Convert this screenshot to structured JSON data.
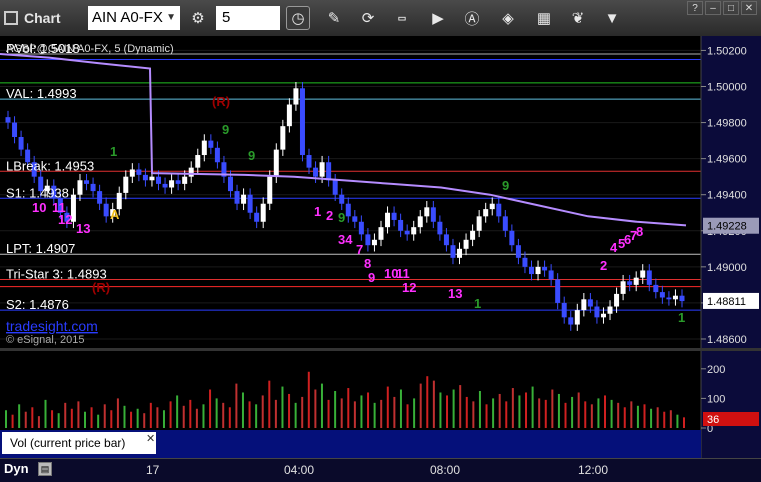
{
  "toolbar": {
    "title": "Chart",
    "symbol": "AIN A0-FX",
    "interval": "5",
    "icons": [
      "settings-icon",
      "clock-icon",
      "pencil-icon",
      "refresh-icon",
      "get-icon",
      "play-icon",
      "text-icon",
      "tag-icon",
      "calendar-icon",
      "twitter-icon",
      "dropdown-icon"
    ]
  },
  "chart_data": [
    {
      "type": "candlestick",
      "title": "AGBP@GAIN A0-FX, 5 (Dynamic)",
      "y_axis_ticks": [
        "1.50200",
        "1.50000",
        "1.49800",
        "1.49600",
        "1.49400",
        "1.49200",
        "1.49000",
        "1.48800",
        "1.48600"
      ],
      "ylim": [
        1.4855,
        1.5028
      ],
      "last_price_label": "1.48811",
      "ma_value_label": "1.49228",
      "x_ticks": [
        "17",
        "04:00",
        "08:00",
        "12:00"
      ],
      "levels": [
        {
          "label": "PVol: 1.5018",
          "value": 1.5018,
          "color": "#b0b0b0"
        },
        {
          "label": "",
          "value": 1.5015,
          "color": "#2a3cff"
        },
        {
          "label": "",
          "value": 1.5002,
          "color": "#22c022"
        },
        {
          "label": "VAL: 1.4993",
          "value": 1.4993,
          "color": "#60c0e0"
        },
        {
          "label": "LBreak: 1.4953",
          "value": 1.4953,
          "color": "#e03030"
        },
        {
          "label": "S1: 1.4938",
          "value": 1.4938,
          "color": "#2a3cff"
        },
        {
          "label": "LPT: 1.4907",
          "value": 1.4907,
          "color": "#c0c0c0"
        },
        {
          "label": "Tri-Star 3: 1.4893",
          "value": 1.4893,
          "color": "#e03030"
        },
        {
          "label": "",
          "value": 1.4889,
          "color": "#ff2a2a"
        },
        {
          "label": "S2: 1.4876",
          "value": 1.4876,
          "color": "#2a3cff"
        }
      ],
      "closes": [
        1.498,
        1.4972,
        1.4965,
        1.4958,
        1.495,
        1.4942,
        1.4945,
        1.4938,
        1.493,
        1.4925,
        1.494,
        1.4948,
        1.4946,
        1.4942,
        1.4935,
        1.4928,
        1.4932,
        1.4941,
        1.495,
        1.4954,
        1.4951,
        1.4948,
        1.495,
        1.4946,
        1.4944,
        1.4948,
        1.4946,
        1.495,
        1.4955,
        1.4962,
        1.497,
        1.4966,
        1.4958,
        1.495,
        1.4942,
        1.4935,
        1.494,
        1.493,
        1.4925,
        1.4935,
        1.495,
        1.4965,
        1.4978,
        1.499,
        1.4999,
        1.4962,
        1.4955,
        1.495,
        1.4958,
        1.4948,
        1.494,
        1.4935,
        1.4928,
        1.4925,
        1.4918,
        1.4912,
        1.4915,
        1.4922,
        1.493,
        1.4926,
        1.492,
        1.4918,
        1.4922,
        1.4928,
        1.4933,
        1.4925,
        1.4918,
        1.4912,
        1.4905,
        1.491,
        1.4915,
        1.492,
        1.4928,
        1.4932,
        1.4935,
        1.4928,
        1.492,
        1.4912,
        1.4905,
        1.49,
        1.4896,
        1.49,
        1.4898,
        1.4893,
        1.488,
        1.4872,
        1.4868,
        1.4876,
        1.4882,
        1.4878,
        1.4872,
        1.4874,
        1.4878,
        1.4885,
        1.4892,
        1.489,
        1.4894,
        1.4898,
        1.489,
        1.4886,
        1.4883,
        1.4882,
        1.4884,
        1.4881
      ],
      "ma_line": [
        1.5018,
        1.5016,
        1.5013,
        1.501,
        1.4952,
        1.4951,
        1.495,
        1.4948,
        1.4946,
        1.4944,
        1.494,
        1.4934,
        1.4928,
        1.4925,
        1.4923
      ],
      "annotations": [
        {
          "text": "(R)",
          "color": "#a00000"
        },
        {
          "text": "(R)",
          "color": "#a00000"
        },
        {
          "text": "A",
          "color": "#f0c020"
        },
        {
          "text": "10",
          "color": "#ff30ff"
        },
        {
          "text": "11",
          "color": "#ff30ff"
        },
        {
          "text": "12",
          "color": "#ff30ff"
        },
        {
          "text": "13",
          "color": "#ff30ff"
        },
        {
          "text": "1",
          "color": "#ff30ff"
        },
        {
          "text": "2",
          "color": "#ff30ff"
        },
        {
          "text": "34",
          "color": "#ff30ff"
        },
        {
          "text": "7",
          "color": "#ff30ff"
        },
        {
          "text": "8",
          "color": "#ff30ff"
        },
        {
          "text": "9",
          "color": "#ff30ff"
        },
        {
          "text": "10",
          "color": "#ff30ff"
        },
        {
          "text": "11",
          "color": "#ff30ff"
        },
        {
          "text": "12",
          "color": "#ff30ff"
        },
        {
          "text": "13",
          "color": "#ff30ff"
        },
        {
          "text": "2",
          "color": "#ff30ff"
        },
        {
          "text": "4",
          "color": "#ff30ff"
        },
        {
          "text": "5",
          "color": "#ff30ff"
        },
        {
          "text": "6",
          "color": "#ff30ff"
        },
        {
          "text": "7",
          "color": "#ff30ff"
        },
        {
          "text": "8",
          "color": "#ff30ff"
        },
        {
          "text": "9",
          "color": "#2a9a2a"
        },
        {
          "text": "9",
          "color": "#2a9a2a"
        },
        {
          "text": "9",
          "color": "#2a9a2a"
        },
        {
          "text": "9",
          "color": "#2a9a2a"
        },
        {
          "text": "1",
          "color": "#2a9a2a"
        },
        {
          "text": "1",
          "color": "#2a9a2a"
        },
        {
          "text": "1",
          "color": "#2a9a2a"
        }
      ],
      "watermarks": [
        "tradesight.com",
        "© eSignal, 2015"
      ]
    },
    {
      "type": "bar",
      "title": "Vol (current price bar)",
      "y_axis_ticks": [
        "200",
        "100",
        "0"
      ],
      "ylim": [
        0,
        250
      ],
      "last_value_label": "36",
      "values": [
        60,
        45,
        80,
        55,
        70,
        40,
        95,
        60,
        50,
        85,
        65,
        90,
        55,
        70,
        45,
        80,
        60,
        100,
        75,
        55,
        65,
        50,
        85,
        70,
        60,
        90,
        110,
        75,
        95,
        65,
        80,
        130,
        100,
        85,
        70,
        150,
        120,
        90,
        80,
        110,
        160,
        95,
        140,
        115,
        85,
        105,
        190,
        130,
        150,
        95,
        125,
        100,
        135,
        90,
        110,
        120,
        85,
        95,
        140,
        105,
        130,
        80,
        100,
        150,
        175,
        160,
        120,
        110,
        130,
        145,
        105,
        90,
        125,
        80,
        100,
        115,
        90,
        135,
        110,
        120,
        140,
        100,
        95,
        130,
        115,
        85,
        105,
        120,
        90,
        80,
        100,
        110,
        95,
        85,
        70,
        90,
        75,
        80,
        65,
        70,
        55,
        60,
        45,
        36
      ]
    }
  ]
}
